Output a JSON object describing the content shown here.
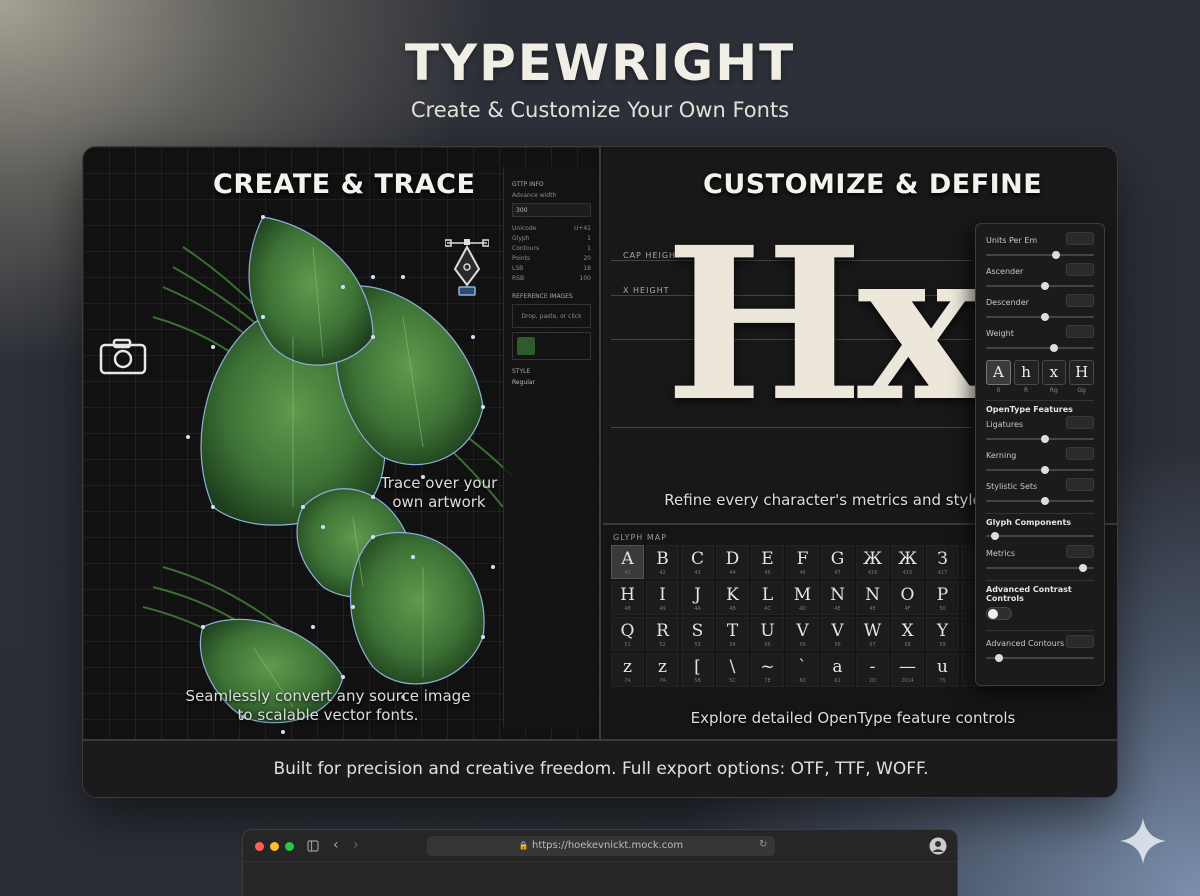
{
  "brand": {
    "title": "TYPEWRIGHT",
    "subtitle": "Create & Customize Your Own Fonts"
  },
  "left": {
    "title": "CREATE & TRACE",
    "caption_trace": "Trace over your own artwork",
    "caption_convert": "Seamlessly convert any source image to scalable vector fonts.",
    "info": {
      "header": "GTTP INFO",
      "advance_label": "Advance width",
      "advance_value": "300",
      "rows": [
        {
          "k": "Unicode",
          "v": "U+41"
        },
        {
          "k": "Glyph",
          "v": "1"
        },
        {
          "k": "Contours",
          "v": "1"
        },
        {
          "k": "Points",
          "v": "20"
        },
        {
          "k": "LSB",
          "v": "18"
        },
        {
          "k": "RSB",
          "v": "100"
        }
      ],
      "ref_header": "REFERENCE IMAGES",
      "ref_hint": "Drop, paste, or click",
      "style_header": "STYLE",
      "style_value": "Regular"
    }
  },
  "right": {
    "title": "CUSTOMIZE & DEFINE",
    "cap_height_label": "CAP HEIGHT",
    "x_height_label": "X HEIGHT",
    "glyphs": "Hx",
    "caption": "Refine every character's metrics and style",
    "glyph_map_title": "GLYPH MAP",
    "glyph_map_caption": "Explore detailed OpenType feature controls",
    "glyph_map": [
      {
        "g": "A",
        "s": "41"
      },
      {
        "g": "B",
        "s": "42"
      },
      {
        "g": "C",
        "s": "43"
      },
      {
        "g": "D",
        "s": "44"
      },
      {
        "g": "E",
        "s": "45"
      },
      {
        "g": "F",
        "s": "46"
      },
      {
        "g": "G",
        "s": "47"
      },
      {
        "g": "Ж",
        "s": "416"
      },
      {
        "g": "Ж",
        "s": "416"
      },
      {
        "g": "З",
        "s": "417"
      },
      {
        "g": "",
        "s": ""
      },
      {
        "g": "H",
        "s": "48"
      },
      {
        "g": "I",
        "s": "49"
      },
      {
        "g": "J",
        "s": "4A"
      },
      {
        "g": "K",
        "s": "4B"
      },
      {
        "g": "L",
        "s": "4C"
      },
      {
        "g": "M",
        "s": "4D"
      },
      {
        "g": "N",
        "s": "4E"
      },
      {
        "g": "N",
        "s": "4E"
      },
      {
        "g": "O",
        "s": "4F"
      },
      {
        "g": "P",
        "s": "50"
      },
      {
        "g": "",
        "s": ""
      },
      {
        "g": "Q",
        "s": "51"
      },
      {
        "g": "R",
        "s": "52"
      },
      {
        "g": "S",
        "s": "53"
      },
      {
        "g": "T",
        "s": "54"
      },
      {
        "g": "U",
        "s": "55"
      },
      {
        "g": "V",
        "s": "56"
      },
      {
        "g": "V",
        "s": "56"
      },
      {
        "g": "W",
        "s": "57"
      },
      {
        "g": "X",
        "s": "58"
      },
      {
        "g": "Y",
        "s": "59"
      },
      {
        "g": "",
        "s": ""
      },
      {
        "g": "z",
        "s": "7A"
      },
      {
        "g": "z",
        "s": "7A"
      },
      {
        "g": "[",
        "s": "5B"
      },
      {
        "g": "\\",
        "s": "5C"
      },
      {
        "g": "~",
        "s": "7E"
      },
      {
        "g": "`",
        "s": "60"
      },
      {
        "g": "a",
        "s": "61"
      },
      {
        "g": "-",
        "s": "2D"
      },
      {
        "g": "—",
        "s": "2014"
      },
      {
        "g": "u",
        "s": "75"
      },
      {
        "g": "",
        "s": ""
      }
    ],
    "controls": {
      "sliders_top": [
        {
          "label": "Units Per Em",
          "level": 0.65
        },
        {
          "label": "Ascender",
          "level": 0.55
        },
        {
          "label": "Descender",
          "level": 0.55
        },
        {
          "label": "Weight",
          "level": 0.63
        }
      ],
      "glyph_buttons": [
        {
          "g": "A",
          "s": "0"
        },
        {
          "g": "h",
          "s": "R"
        },
        {
          "g": "x",
          "s": "Rg"
        },
        {
          "g": "H",
          "s": "Gg"
        }
      ],
      "opentype_header": "OpenType Features",
      "sliders_ot": [
        {
          "label": "Ligatures",
          "level": 0.55
        },
        {
          "label": "Kerning",
          "level": 0.55
        },
        {
          "label": "Stylistic Sets",
          "level": 0.55
        }
      ],
      "components_header": "Glyph Components",
      "components_level": 0.08,
      "metrics_label": "Metrics",
      "metrics_level": 0.9,
      "advanced_header": "Advanced Contrast Controls",
      "advanced_label": "Advanced Contours",
      "advanced_level": 0.12
    }
  },
  "footer": "Built for precision and creative freedom. Full export options: OTF, TTF, WOFF.",
  "browser": {
    "url": "https://hoekevnickt.mock.com"
  }
}
